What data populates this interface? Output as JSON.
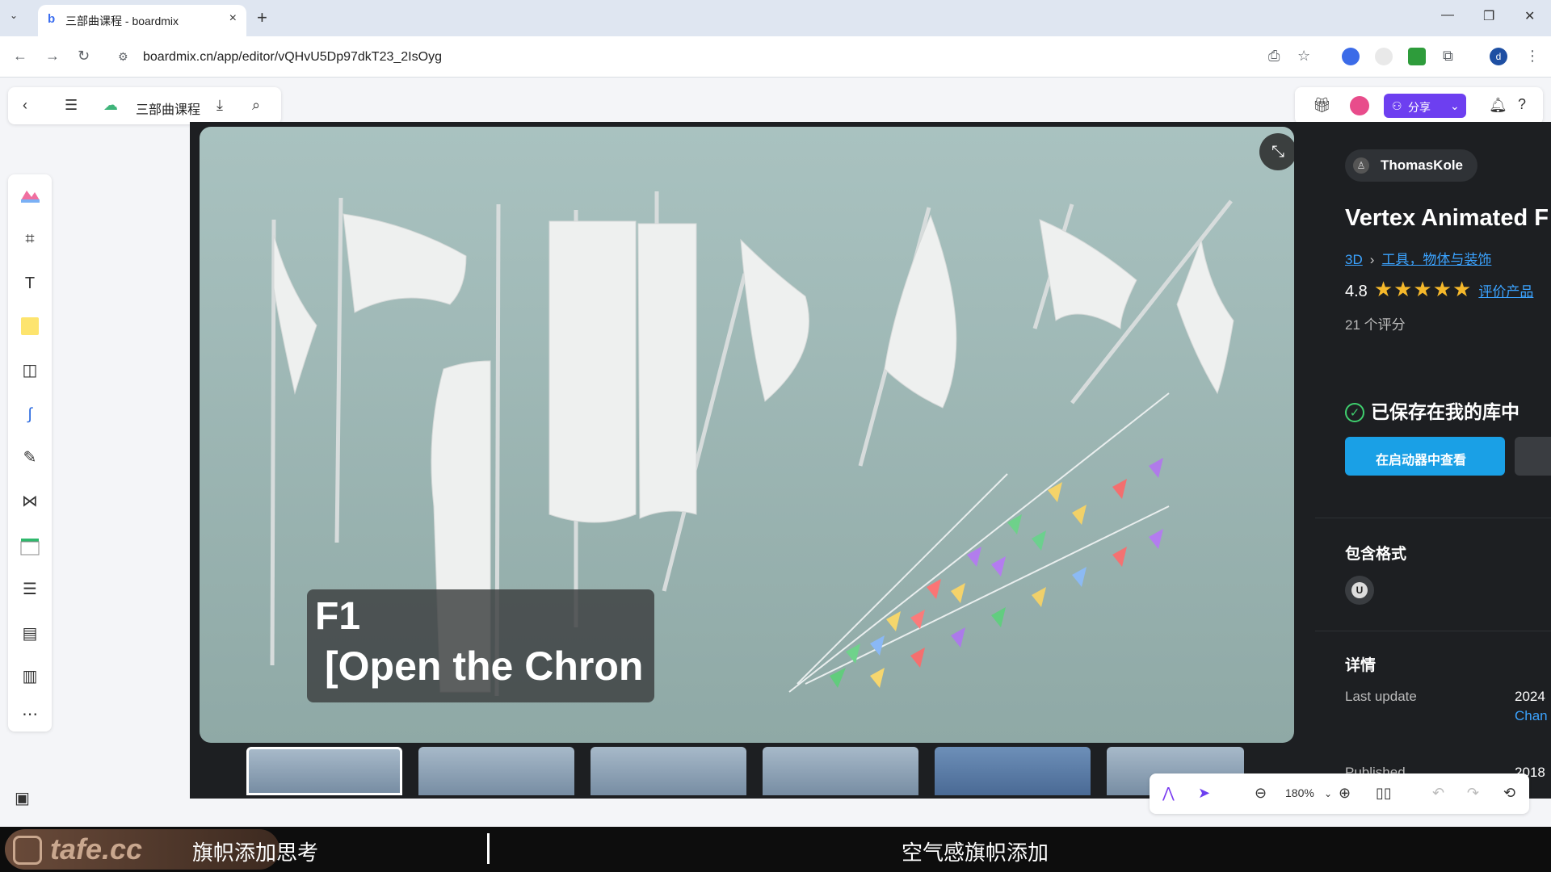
{
  "browser": {
    "tab_title": "三部曲课程 - boardmix",
    "url": "boardmix.cn/app/editor/vQHvU5Dp97dkT23_2IsOyg"
  },
  "app": {
    "board_name": "三部曲课程",
    "share_label": "分享",
    "zoom": "180%"
  },
  "viewer": {
    "caption_line1": "F1",
    "caption_line2": "[Open the Chron"
  },
  "panel": {
    "author": "ThomasKole",
    "title": "Vertex Animated F",
    "breadcrumb": [
      "3D",
      "工具，物体与装饰"
    ],
    "rating_value": "4.8",
    "stars": 5,
    "rate_link": "评价产品",
    "reviews": "21 个评分",
    "saved_text": "已保存在我的库中",
    "launch_button": "在启动器中查看",
    "formats_heading": "包含格式",
    "format_icon": "U",
    "details_heading": "详情",
    "last_update_label": "Last update",
    "last_update_value": "2024",
    "changelog_link": "Chan",
    "published_label": "Published",
    "published_value": "2018"
  },
  "subtitles": {
    "logo": "tafe.cc",
    "left": "旗帜添加思考",
    "right": "空气感旗帜添加"
  },
  "colors": {
    "accent": "#6d3ff0",
    "launch": "#1aa0e6",
    "link": "#3ba3ff",
    "star": "#f5b82b"
  }
}
